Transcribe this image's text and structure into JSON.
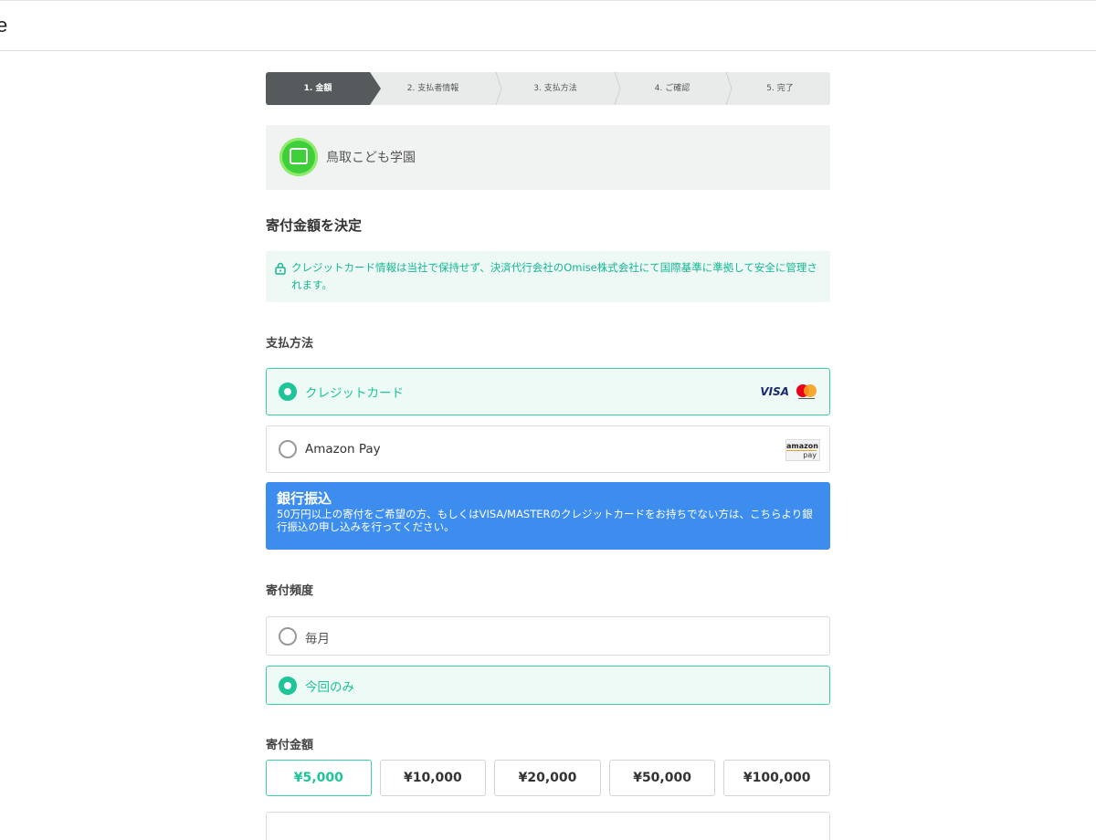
{
  "header": {
    "logo_text": "e"
  },
  "stepper": {
    "steps": [
      "1. 金額",
      "2. 支払者情報",
      "3. 支払方法",
      "4. ご確認",
      "5. 完了"
    ],
    "active_index": 0
  },
  "organization": {
    "name": "鳥取こども学園"
  },
  "section_title": "寄付金額を決定",
  "notice": {
    "text": "クレジットカード情報は当社で保持せず、決済代行会社のOmise株式会社にて国際基準に準拠して安全に管理されます。"
  },
  "payment": {
    "label": "支払方法",
    "options": [
      {
        "label": "クレジットカード",
        "selected": true,
        "badges": [
          "VISA",
          "mastercard"
        ]
      },
      {
        "label": "Amazon Pay",
        "selected": false,
        "badge_top": "amazon",
        "badge_bottom": "pay"
      }
    ],
    "bank": {
      "title": "銀行振込",
      "desc": "50万円以上の寄付をご希望の方、もしくはVISA/MASTERのクレジットカードをお持ちでない方は、こちらより銀行振込の申し込みを行ってください。"
    }
  },
  "frequency": {
    "label": "寄付頻度",
    "options": [
      {
        "label": "毎月",
        "selected": false
      },
      {
        "label": "今回のみ",
        "selected": true
      }
    ]
  },
  "amount": {
    "label": "寄付金額",
    "options": [
      "¥5,000",
      "¥10,000",
      "¥20,000",
      "¥50,000",
      "¥100,000"
    ],
    "selected_index": 0
  },
  "colors": {
    "accent": "#1dc598",
    "bank_blue": "#3d8def",
    "stepper_active": "#555a5c"
  }
}
